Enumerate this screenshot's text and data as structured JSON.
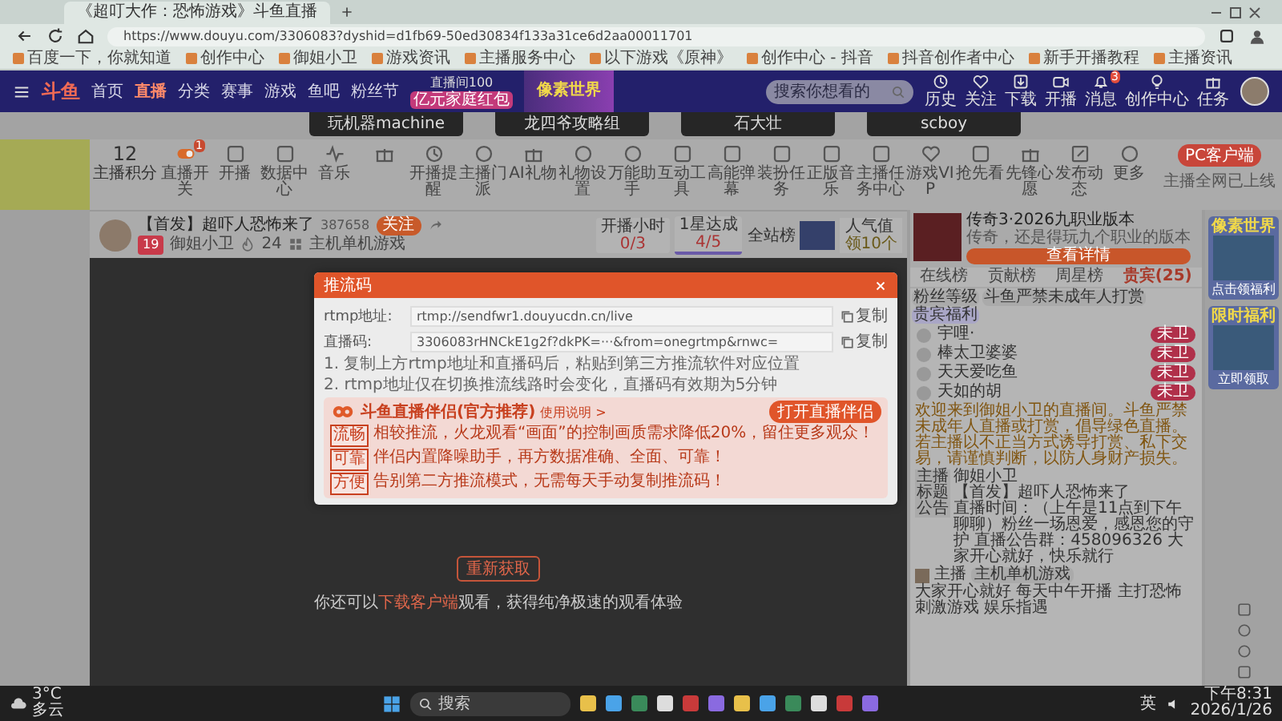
{
  "browser": {
    "tab_title": "《超叮大作：恐怖游戏》斗鱼直播",
    "url": "https://www.douyu.com/3306083?dyshid=d1fb69-50ed30834f133a31ce6d2aa00011701",
    "bookmarks": [
      "百度一下，你就知道",
      "创作中心",
      "御姐小卫",
      "游戏资讯",
      "主播服务中心",
      "以下游戏《原神》",
      "创作中心 - 抖音",
      "抖音创作者中心",
      "新手开播教程",
      "主播资讯"
    ]
  },
  "nav": {
    "logo": "斗鱼",
    "links": [
      {
        "label": "首页",
        "selected": false
      },
      {
        "label": "直播",
        "selected": true
      },
      {
        "label": "分类",
        "selected": false
      },
      {
        "label": "赛事",
        "selected": false
      },
      {
        "label": "游戏",
        "selected": false
      },
      {
        "label": "鱼吧",
        "selected": false
      },
      {
        "label": "粉丝节",
        "selected": false
      }
    ],
    "promo": {
      "top": "直播间100",
      "bottom": "亿元家庭红包"
    },
    "banner": "像素世界",
    "search": {
      "placeholder": "搜索你想看的"
    },
    "actions": [
      {
        "label": "历史",
        "kind": "clock"
      },
      {
        "label": "关注",
        "kind": "heart"
      },
      {
        "label": "下载",
        "kind": "download"
      },
      {
        "label": "开播",
        "kind": "camera"
      },
      {
        "label": "消息",
        "kind": "bell",
        "badge": "3"
      },
      {
        "label": "创作中心",
        "kind": "bulb"
      },
      {
        "label": "任务",
        "kind": "gift"
      }
    ]
  },
  "featured": [
    "玩机器machine",
    "龙四爷攻略组",
    "石大壮",
    "scboy"
  ],
  "toolbar": {
    "points": {
      "value": "12",
      "label": "主播积分"
    },
    "items": [
      {
        "label": "直播开关",
        "kind": "toggle",
        "badge": "1"
      },
      {
        "label": "开播",
        "kind": "square"
      },
      {
        "label": "数据中心",
        "kind": "square"
      },
      {
        "label": "音乐",
        "kind": "wave"
      },
      {
        "kind": "gift"
      },
      {
        "label": "开播提醒",
        "kind": "clock"
      },
      {
        "label": "主播门派",
        "kind": "circle"
      },
      {
        "label": "AI礼物",
        "kind": "gift"
      },
      {
        "label": "礼物设置",
        "kind": "circle"
      },
      {
        "label": "万能助手",
        "kind": "circle"
      },
      {
        "label": "互动工具",
        "kind": "square"
      },
      {
        "label": "高能弹幕",
        "kind": "square"
      },
      {
        "label": "装扮任务",
        "kind": "square"
      },
      {
        "label": "正版音乐",
        "kind": "square"
      },
      {
        "label": "主播任务中心",
        "kind": "square"
      },
      {
        "label": "游戏VIP",
        "kind": "heart"
      },
      {
        "label": "抢先看",
        "kind": "square"
      },
      {
        "label": "先锋心愿",
        "kind": "gift"
      },
      {
        "label": "发布动态",
        "kind": "pen"
      },
      {
        "label": "更多",
        "kind": "circle"
      }
    ],
    "client_button": "PC客户端",
    "client_note": "主播全网已上线"
  },
  "room": {
    "title": "【首发】超吓人恐怖来了",
    "room_id": "387658",
    "follow": "关注",
    "level": "19",
    "host": "御姐小卫",
    "hot": "24",
    "category": "主机单机游戏",
    "stats": [
      {
        "label": "开播小时",
        "value": "0/3",
        "selected": false
      },
      {
        "label": "1星达成",
        "value": "4/5",
        "selected": true
      }
    ],
    "rank": "全站榜",
    "popularity": {
      "label": "人气值",
      "value": "领10个"
    }
  },
  "dialog": {
    "title": "推流码",
    "fields": [
      {
        "label": "rtmp地址:",
        "value": "rtmp://sendfwr1.douyucdn.cn/live",
        "copy": "复制"
      },
      {
        "label": "直播码:",
        "value": "3306083rHNCkE1g2f?dkPK=···&from=onegrtmp&rnwc=",
        "copy": "复制"
      }
    ],
    "notes": [
      "1. 复制上方rtmp地址和直播码后，粘贴到第三方推流软件对应位置",
      "2. rtmp地址仅在切换推流线路时会变化，直播码有效期为5分钟"
    ],
    "promo": {
      "title": "斗鱼直播伴侣(官方推荐)",
      "help": "使用说明 >",
      "button": "打开直播伴侣",
      "points": [
        {
          "tag": "流畅",
          "text": "相较推流，火龙观看“画面”的控制画质需求降低20%，留住更多观众！"
        },
        {
          "tag": "可靠",
          "text": "伴侣内置降噪助手，再方数据准确、全面、可靠！"
        },
        {
          "tag": "方便",
          "text": "告别第二方推流模式，无需每天手动复制推流码！"
        }
      ]
    }
  },
  "video": {
    "retry": "重新获取",
    "hint_before": "你还可以",
    "hint_link": "下载客户端",
    "hint_after": "观看，获得纯净极速的观看体验"
  },
  "sidebar": {
    "ad": {
      "title": "传奇3·2026九职业版本",
      "text": "传奇，还是得玩九个职业的版本",
      "button": "查看详情"
    },
    "tabs": [
      {
        "label": "在线榜",
        "selected": false
      },
      {
        "label": "贡献榜",
        "selected": false
      },
      {
        "label": "周星榜",
        "selected": false
      },
      {
        "label": "贵宾(25)",
        "selected": true
      }
    ],
    "filter": [
      "粉丝等级",
      "斗鱼严禁未成年人打赏",
      "贵宾福利"
    ],
    "viewers": [
      {
        "name": "宇哩·",
        "badge": "未卫"
      },
      {
        "name": "棒太卫婆婆",
        "badge": "未卫"
      },
      {
        "name": "天天爱吃鱼",
        "badge": "未卫"
      },
      {
        "name": "天如的胡",
        "badge": "未卫"
      }
    ],
    "notice": "欢迎来到御姐小卫的直播间。斗鱼严禁未成年人直播或打赏，倡导绿色直播。若主播以不正当方式诱导打赏、私下交易，请谨慎判断，以防人身财产损失。",
    "info": [
      {
        "key": "主播",
        "value": "御姐小卫"
      },
      {
        "key": "标题",
        "value": "【首发】超吓人恐怖来了"
      },
      {
        "key": "公告",
        "value": "直播时间：（上午是11点到下午聊聊）粉丝一场恩爱，感恩您的守护 直播公告群：458096326 大家开心就好，快乐就行"
      }
    ],
    "chat": {
      "user": "主播",
      "tag": "主机单机游戏",
      "text": "大家开心就好 每天中午开播 主打恐怖刺激游戏 娱乐指遇"
    }
  },
  "side_ads": [
    {
      "title": "像素世界",
      "caption": "点击领福利"
    },
    {
      "title": "限时福利",
      "caption": "立即领取"
    }
  ],
  "taskbar": {
    "weather": {
      "temp": "3°C",
      "text": "多云"
    },
    "search": {
      "placeholder": "搜索"
    },
    "ime": "英",
    "time": "下午8:31",
    "date": "2026/1/26"
  }
}
